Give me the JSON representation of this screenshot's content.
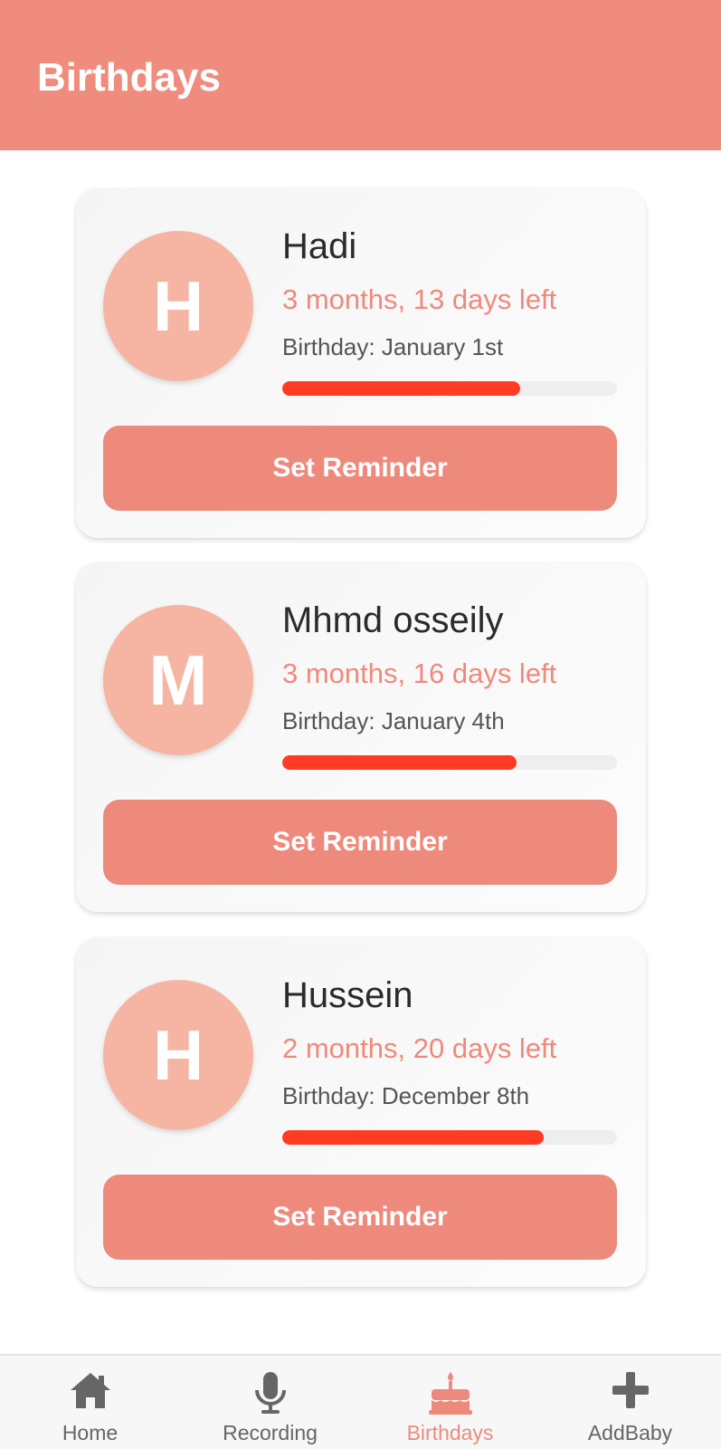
{
  "header": {
    "title": "Birthdays"
  },
  "colors": {
    "header_bg": "#F08C7E",
    "accent": "#EE8A7C",
    "avatar_bg": "#F5B5A2",
    "progress_fill": "#FF3B24",
    "inactive_icon": "#666666"
  },
  "birthdays": [
    {
      "initial": "H",
      "name": "Hadi",
      "countdown": "3 months, 13 days left",
      "birthday": "Birthday: January 1st",
      "progress_percent": 71,
      "button_label": "Set Reminder"
    },
    {
      "initial": "M",
      "name": "Mhmd osseily",
      "countdown": "3 months, 16 days left",
      "birthday": "Birthday: January 4th",
      "progress_percent": 70,
      "button_label": "Set Reminder"
    },
    {
      "initial": "H",
      "name": "Hussein",
      "countdown": "2 months, 20 days left",
      "birthday": "Birthday: December 8th",
      "progress_percent": 78,
      "button_label": "Set Reminder"
    }
  ],
  "nav": {
    "items": [
      {
        "label": "Home",
        "icon": "home-icon",
        "active": false
      },
      {
        "label": "Recording",
        "icon": "microphone-icon",
        "active": false
      },
      {
        "label": "Birthdays",
        "icon": "cake-icon",
        "active": true
      },
      {
        "label": "AddBaby",
        "icon": "plus-icon",
        "active": false
      }
    ]
  }
}
